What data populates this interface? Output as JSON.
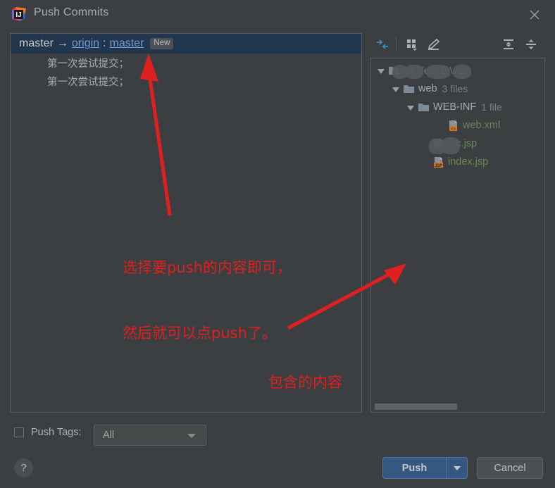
{
  "window": {
    "title": "Push Commits",
    "app_icon": "intellij-idea-icon",
    "close_icon": "close-icon"
  },
  "commits_panel": {
    "repo_row": {
      "local_branch": "master",
      "arrow": "→",
      "remote": "origin",
      "separator": ":",
      "remote_branch": "master",
      "badge": "New"
    },
    "commits": [
      {
        "message": "第一次尝试提交；"
      },
      {
        "message": "第一次尝试提交；"
      }
    ]
  },
  "tree_toolbar": {
    "buttons": [
      {
        "name": "collapse-diff-icon",
        "title": "Collapse"
      },
      {
        "name": "group-by-icon",
        "title": "Group By"
      },
      {
        "name": "edit-source-icon",
        "title": "Edit Source"
      },
      {
        "name": "expand-all-icon",
        "title": "Expand All"
      },
      {
        "name": "collapse-all-icon",
        "title": "Collapse All"
      }
    ]
  },
  "file_tree": {
    "rows": [
      {
        "indent": 0,
        "twisty": "expanded",
        "icon": "module-folder-icon",
        "label": "",
        "redacted": true,
        "count": "3 files",
        "path": "E:\\Jet",
        "color": "default"
      },
      {
        "indent": 1,
        "twisty": "expanded",
        "icon": "folder-icon",
        "label": "web",
        "redacted": false,
        "count": "3 files",
        "path": "",
        "color": "default"
      },
      {
        "indent": 2,
        "twisty": "expanded",
        "icon": "folder-icon",
        "label": "WEB-INF",
        "redacted": false,
        "count": "1 file",
        "path": "",
        "color": "default"
      },
      {
        "indent": 4,
        "twisty": "none",
        "icon": "xml-file-icon",
        "label": "web.xml",
        "redacted": false,
        "count": "",
        "path": "",
        "color": "green"
      },
      {
        "indent": 3,
        "twisty": "none",
        "icon": "jsp-file-icon",
        "label": "nic.jsp",
        "redacted": true,
        "count": "",
        "path": "",
        "color": "green"
      },
      {
        "indent": 3,
        "twisty": "none",
        "icon": "jsp-file-icon",
        "label": "index.jsp",
        "redacted": false,
        "count": "",
        "path": "",
        "color": "green"
      }
    ],
    "scrollbar": "horizontal"
  },
  "footer": {
    "push_tags_label": "Push Tags:",
    "push_tags_checked": false,
    "tags_scope_value": "All",
    "help_label": "?",
    "push_label": "Push",
    "push_dropdown_icon": "chevron-down-icon",
    "cancel_label": "Cancel"
  },
  "annotations": [
    {
      "name": "annotation-select-push-content",
      "line1": "选择要push的内容即可，",
      "line2": "然后就可以点push了。"
    },
    {
      "name": "annotation-included-content",
      "line1": "包含的内容",
      "line2": ""
    }
  ],
  "colors": {
    "window_bg": "#3c3f41",
    "selection_bg": "#22364e",
    "link": "#6f9ad6",
    "accent_button": "#365880",
    "file_green": "#6a8759",
    "annotation_red": "#e02020"
  }
}
